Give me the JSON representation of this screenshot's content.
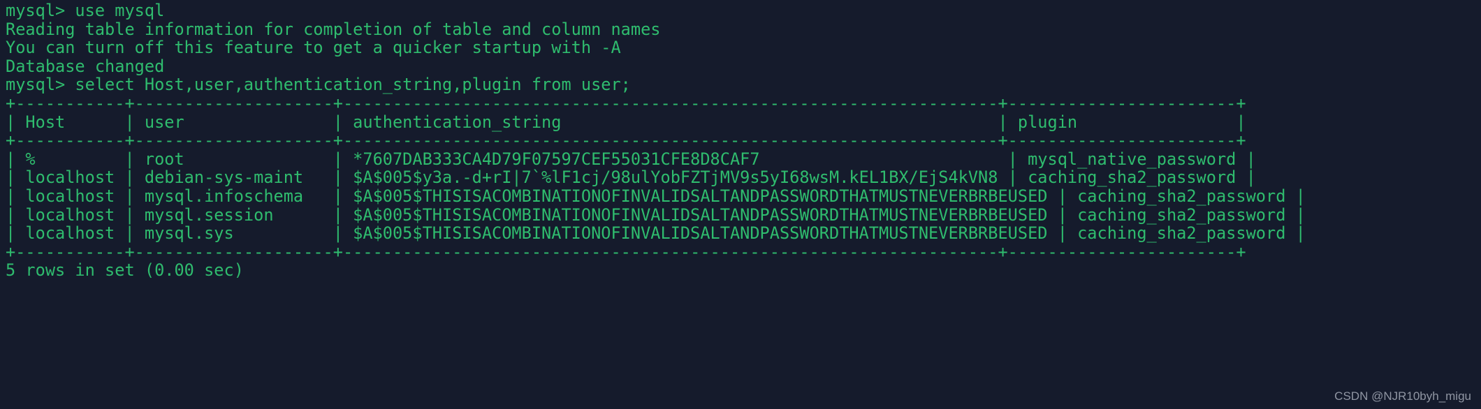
{
  "terminal": {
    "background_color": "#151b2c",
    "text_color": "#2fbc6e",
    "prompt": "mysql> ",
    "lines": [
      "mysql> use mysql",
      "Reading table information for completion of table and column names",
      "You can turn off this feature to get a quicker startup with -A",
      "",
      "Database changed",
      "mysql> select Host,user,authentication_string,plugin from user;",
      "+-----------+--------------------+------------------------------------------------------------------+-----------------------+",
      "| Host      | user               | authentication_string                                            | plugin                |",
      "+-----------+--------------------+------------------------------------------------------------------+-----------------------+",
      "| %         | root               | *7607DAB333CA4D79F07597CEF55031CFE8D8CAF7                         | mysql_native_password |",
      "| localhost | debian-sys-maint   | $A$005$y3a.-d+rI|7`%lF1cj/98ulYobFZTjMV9s5yI68wsM.kEL1BX/EjS4kVN8 | caching_sha2_password |",
      "| localhost | mysql.infoschema   | $A$005$THISISACOMBINATIONOFINVALIDSALTANDPASSWORDTHATMUSTNEVERBRBEUSED | caching_sha2_password |",
      "| localhost | mysql.session      | $A$005$THISISACOMBINATIONOFINVALIDSALTANDPASSWORDTHATMUSTNEVERBRBEUSED | caching_sha2_password |",
      "| localhost | mysql.sys          | $A$005$THISISACOMBINATIONOFINVALIDSALTANDPASSWORDTHATMUSTNEVERBRBEUSED | caching_sha2_password |",
      "+-----------+--------------------+------------------------------------------------------------------+-----------------------+",
      "5 rows in set (0.00 sec)"
    ],
    "commands": {
      "use_database": "use mysql",
      "select_query": "select Host,user,authentication_string,plugin from user;"
    },
    "messages": {
      "reading_table_info": "Reading table information for completion of table and column names",
      "turn_off_hint": "You can turn off this feature to get a quicker startup with -A",
      "database_changed": "Database changed",
      "result_summary": "5 rows in set (0.00 sec)"
    },
    "result_table": {
      "columns": [
        "Host",
        "user",
        "authentication_string",
        "plugin"
      ],
      "rows": [
        {
          "Host": "%",
          "user": "root",
          "authentication_string": "*7607DAB333CA4D79F07597CEF55031CFE8D8CAF7",
          "plugin": "mysql_native_password"
        },
        {
          "Host": "localhost",
          "user": "debian-sys-maint",
          "authentication_string": "$A$005$y3a.-d+rI|7`%lF1cj/98ulYobFZTjMV9s5yI68wsM.kEL1BX/EjS4kVN8",
          "plugin": "caching_sha2_password"
        },
        {
          "Host": "localhost",
          "user": "mysql.infoschema",
          "authentication_string": "$A$005$THISISACOMBINATIONOFINVALIDSALTANDPASSWORDTHATMUSTNEVERBRBEUSED",
          "plugin": "caching_sha2_password"
        },
        {
          "Host": "localhost",
          "user": "mysql.session",
          "authentication_string": "$A$005$THISISACOMBINATIONOFINVALIDSALTANDPASSWORDTHATMUSTNEVERBRBEUSED",
          "plugin": "caching_sha2_password"
        },
        {
          "Host": "localhost",
          "user": "mysql.sys",
          "authentication_string": "$A$005$THISISACOMBINATIONOFINVALIDSALTANDPASSWORDTHATMUSTNEVERBRBEUSED",
          "plugin": "caching_sha2_password"
        }
      ],
      "row_count": 5
    }
  },
  "watermark": {
    "text": "CSDN @NJR10byh_migu",
    "color": "#9aa0ad"
  }
}
